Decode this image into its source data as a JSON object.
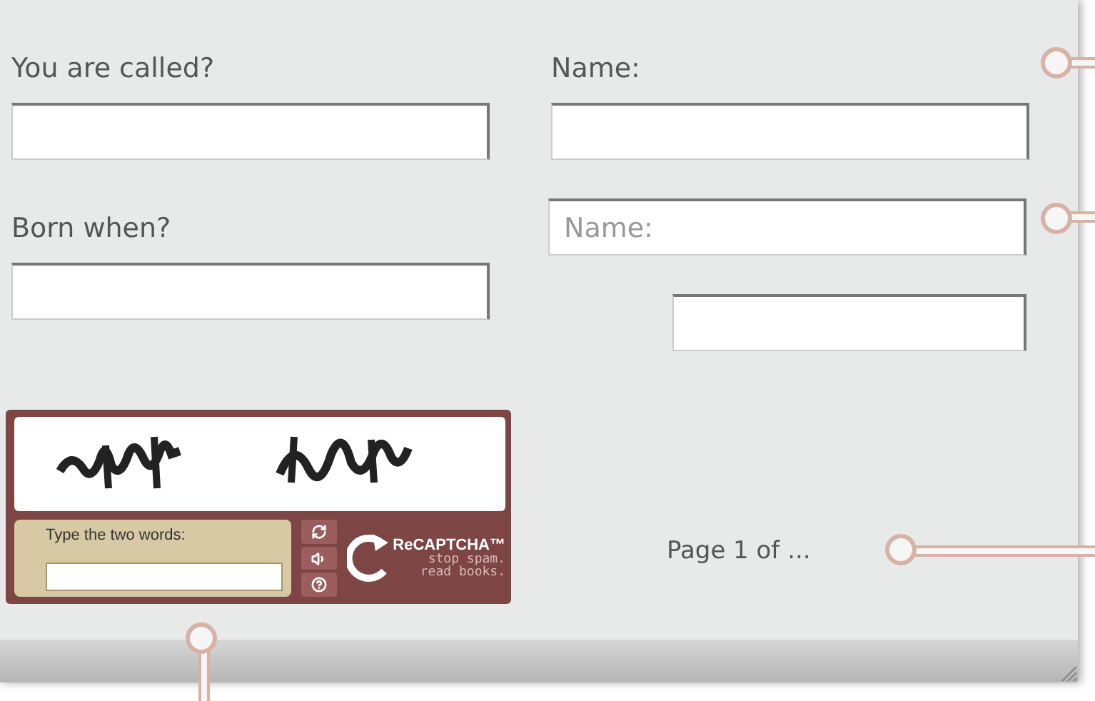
{
  "fields_left": [
    {
      "kind": "labeled",
      "label": "You are called?"
    },
    {
      "kind": "labeled",
      "label": "Born when?"
    }
  ],
  "fields_right": [
    {
      "kind": "labeled",
      "label": "Name:"
    },
    {
      "kind": "placeholder",
      "placeholder": "Name:"
    },
    {
      "kind": "blank"
    }
  ],
  "captcha": {
    "prompt": "Type the two words:",
    "logo": "ReCAPTCHA™",
    "tagline": [
      "stop spam.",
      "read books."
    ]
  },
  "pager": "Page 1 of ..."
}
